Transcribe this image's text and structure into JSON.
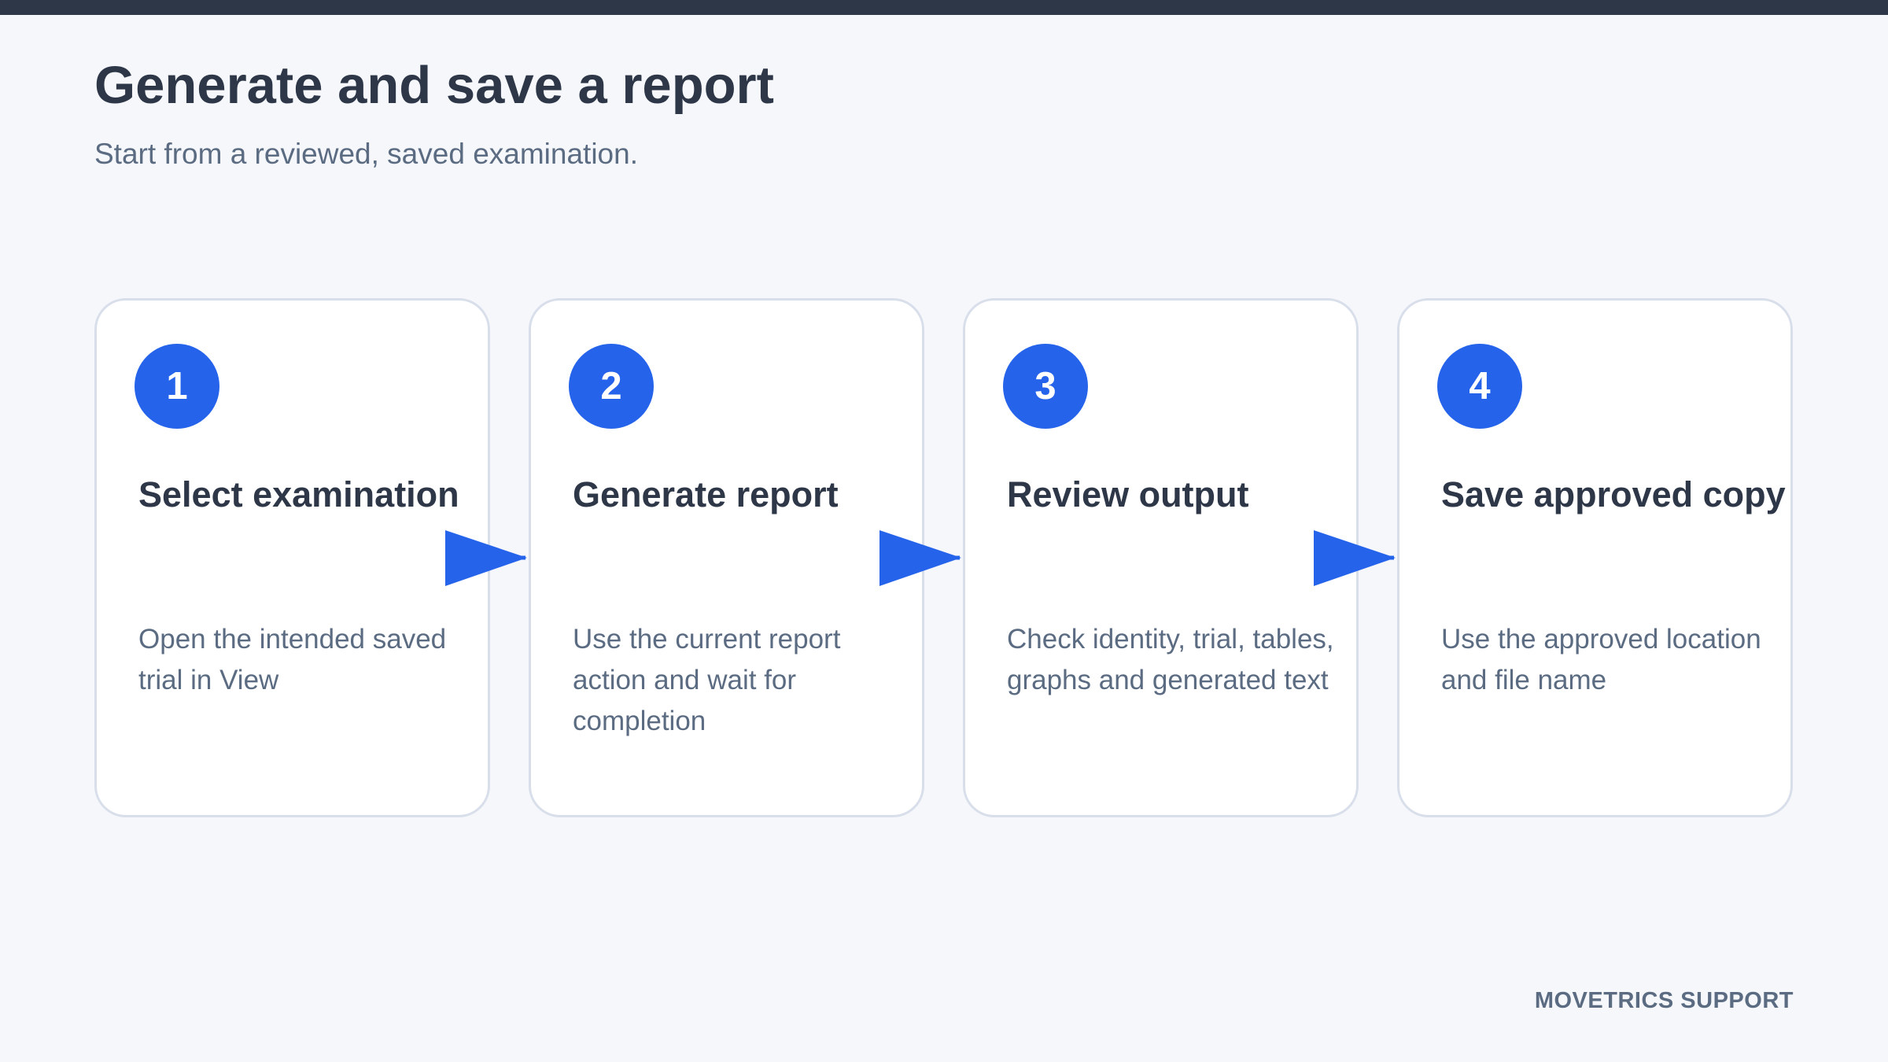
{
  "header": {
    "title": "Generate and save a report",
    "subtitle": "Start from a reviewed, saved examination."
  },
  "steps": [
    {
      "number": "1",
      "title": "Select examination",
      "description": "Open the intended saved trial in View"
    },
    {
      "number": "2",
      "title": "Generate report",
      "description": "Use the current report action and wait for completion"
    },
    {
      "number": "3",
      "title": "Review output",
      "description": "Check identity, trial, tables, graphs and generated text"
    },
    {
      "number": "4",
      "title": "Save approved copy",
      "description": "Use the approved location and file name"
    }
  ],
  "footer": {
    "brand": "MOVETRICS SUPPORT"
  },
  "colors": {
    "accent": "#2563eb",
    "dark": "#2d3748",
    "muted": "#5a6b82",
    "card_border": "#d9dfea",
    "background": "#f5f7fb"
  },
  "icons": {
    "connector": "arrow-right-icon"
  }
}
